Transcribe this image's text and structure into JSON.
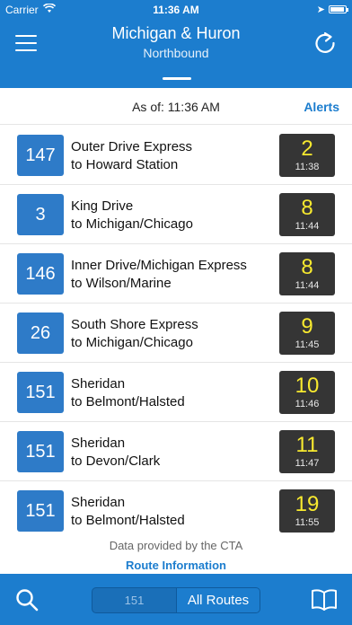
{
  "status_bar": {
    "carrier": "Carrier",
    "time": "11:36 AM"
  },
  "header": {
    "title": "Michigan & Huron",
    "direction": "Northbound"
  },
  "info": {
    "as_of": "As of: 11:36 AM",
    "alerts_label": "Alerts"
  },
  "arrivals": [
    {
      "route": "147",
      "name": "Outer Drive Express",
      "destination": "to Howard Station",
      "minutes": "2",
      "time": "11:38"
    },
    {
      "route": "3",
      "name": "King Drive",
      "destination": "to Michigan/Chicago",
      "minutes": "8",
      "time": "11:44"
    },
    {
      "route": "146",
      "name": "Inner Drive/Michigan Express",
      "destination": "to Wilson/Marine",
      "minutes": "8",
      "time": "11:44"
    },
    {
      "route": "26",
      "name": "South Shore Express",
      "destination": "to Michigan/Chicago",
      "minutes": "9",
      "time": "11:45"
    },
    {
      "route": "151",
      "name": "Sheridan",
      "destination": "to Belmont/Halsted",
      "minutes": "10",
      "time": "11:46"
    },
    {
      "route": "151",
      "name": "Sheridan",
      "destination": "to Devon/Clark",
      "minutes": "11",
      "time": "11:47"
    },
    {
      "route": "151",
      "name": "Sheridan",
      "destination": "to Belmont/Halsted",
      "minutes": "19",
      "time": "11:55"
    }
  ],
  "footer": {
    "credit": "Data provided by the CTA",
    "route_info_label": "Route Information"
  },
  "tabbar": {
    "segment_left": "151",
    "segment_right": "All Routes"
  },
  "icons": {
    "menu": "hamburger-icon",
    "refresh": "refresh-icon",
    "search": "search-icon",
    "routes": "book-icon"
  },
  "colors": {
    "header": "#1c7dce",
    "route_badge": "#2e7bc8",
    "eta_bg": "#353535",
    "eta_text": "#f7e92f"
  }
}
